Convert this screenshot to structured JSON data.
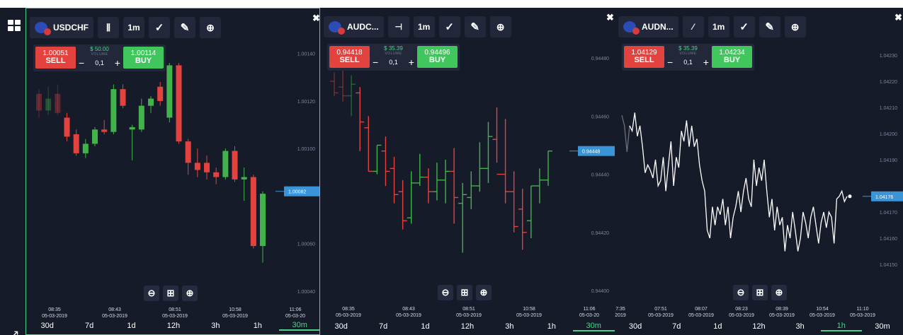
{
  "layout_icon": "grid-layout-icon",
  "expand_icon": "expand-arrow-icon",
  "close_label": "✖",
  "zoom_icons": {
    "out": "⊖",
    "fit": "⊞",
    "in": "⊕"
  },
  "panels": [
    {
      "symbol": "USDCHF",
      "chart_type_icon": "candlestick-icon",
      "interval": "1m",
      "sell_price": "1.00051",
      "sell_label": "SELL",
      "buy_price": "1.00114",
      "buy_label": "BUY",
      "margin": "$ 50.00",
      "volume_label": "VOLUME",
      "volume": "0,1",
      "minus": "−",
      "plus": "+",
      "price_labels": [
        "1.00140",
        "1.00120",
        "1.00100",
        "1.00060",
        "1.00040"
      ],
      "current_price": "1.00082",
      "time_ticks": [
        {
          "time": "08:35",
          "date": "05-03-2019"
        },
        {
          "time": "08:43",
          "date": "05-03-2019"
        },
        {
          "time": "08:51",
          "date": "05-03-2019"
        },
        {
          "time": "10:58",
          "date": "05-03-2019"
        },
        {
          "time": "11:06",
          "date": "05-03-20"
        }
      ],
      "timeframes": [
        "30d",
        "7d",
        "1d",
        "12h",
        "3h",
        "1h",
        "30m"
      ],
      "selected_tf": "30m"
    },
    {
      "symbol": "AUDC...",
      "chart_type_icon": "ohlc-bars-icon",
      "interval": "1m",
      "sell_price": "0.94418",
      "sell_label": "SELL",
      "buy_price": "0.94496",
      "buy_label": "BUY",
      "margin": "$ 35.39",
      "volume_label": "VOLUME",
      "volume": "0,1",
      "minus": "−",
      "plus": "+",
      "price_labels": [
        "0.94480",
        "0.94460",
        "0.94440",
        "0.94420",
        "0.94400"
      ],
      "current_price": "0.94448",
      "time_ticks": [
        {
          "time": "08:35",
          "date": "05-03-2019"
        },
        {
          "time": "08:43",
          "date": "05-03-2019"
        },
        {
          "time": "08:51",
          "date": "05-03-2019"
        },
        {
          "time": "10:58",
          "date": "05-03-2019"
        },
        {
          "time": "11:06",
          "date": "05-03-20"
        }
      ],
      "timeframes": [
        "30d",
        "7d",
        "1d",
        "12h",
        "3h",
        "1h",
        "30m"
      ],
      "selected_tf": "30m"
    },
    {
      "symbol": "AUDN...",
      "chart_type_icon": "line-chart-icon",
      "interval": "1m",
      "sell_price": "1.04129",
      "sell_label": "SELL",
      "buy_price": "1.04234",
      "buy_label": "BUY",
      "margin": "$ 35.39",
      "volume_label": "VOLUME",
      "volume": "0,1",
      "minus": "−",
      "plus": "+",
      "price_labels": [
        "1.04230",
        "1.04220",
        "1.04210",
        "1.04200",
        "1.04190",
        "1.04170",
        "1.04160",
        "1.04150"
      ],
      "current_price": "1.04176",
      "time_ticks": [
        {
          "time": "7:35",
          "date": "2019"
        },
        {
          "time": "07:51",
          "date": "05-03-2019"
        },
        {
          "time": "08:07",
          "date": "05-03-2019"
        },
        {
          "time": "08:23",
          "date": "05-03-2019"
        },
        {
          "time": "08:39",
          "date": "05-03-2019"
        },
        {
          "time": "10:54",
          "date": "05-03-2019"
        },
        {
          "time": "11:10",
          "date": "05-03-2019"
        }
      ],
      "timeframes": [
        "30d",
        "7d",
        "1d",
        "12h",
        "3h",
        "1h",
        "30m"
      ],
      "selected_tf": "1h"
    }
  ],
  "chart_data": [
    {
      "type": "candlestick",
      "symbol": "USDCHF",
      "ylim": [
        1.0004,
        1.0015
      ],
      "candles": [
        [
          1.00123,
          1.00125,
          1.00113,
          1.00116
        ],
        [
          1.00116,
          1.00126,
          1.00114,
          1.00121
        ],
        [
          1.00123,
          1.00127,
          1.00114,
          1.00115
        ],
        [
          1.00113,
          1.00115,
          1.00103,
          1.00105
        ],
        [
          1.00106,
          1.00108,
          1.00097,
          1.00098
        ],
        [
          1.00098,
          1.00104,
          1.00096,
          1.00102
        ],
        [
          1.00102,
          1.00109,
          1.00101,
          1.00108
        ],
        [
          1.00108,
          1.00112,
          1.00106,
          1.00107
        ],
        [
          1.00107,
          1.00127,
          1.00106,
          1.00125
        ],
        [
          1.00125,
          1.00127,
          1.00117,
          1.00118
        ],
        [
          1.00108,
          1.0011,
          1.00095,
          1.00109
        ],
        [
          1.00108,
          1.00121,
          1.00107,
          1.00118
        ],
        [
          1.00118,
          1.00122,
          1.00115,
          1.00121
        ],
        [
          1.00126,
          1.00128,
          1.00118,
          1.0012
        ],
        [
          1.00113,
          1.00136,
          1.00111,
          1.00135
        ],
        [
          1.00135,
          1.00136,
          1.00102,
          1.00103
        ],
        [
          1.00103,
          1.00104,
          1.00089,
          1.00094
        ],
        [
          1.00094,
          1.001,
          1.00088,
          1.00091
        ],
        [
          1.00094,
          1.00097,
          1.00087,
          1.0009
        ],
        [
          1.0009,
          1.00092,
          1.00085,
          1.00088
        ],
        [
          1.00088,
          1.001,
          1.00087,
          1.00099
        ],
        [
          1.00099,
          1.00101,
          1.00086,
          1.00087
        ],
        [
          1.00087,
          1.00092,
          1.00078,
          1.00088
        ],
        [
          1.00088,
          1.00089,
          1.00058,
          1.00059
        ],
        [
          1.00059,
          1.00082,
          1.00052,
          1.00081
        ]
      ]
    },
    {
      "type": "ohlc",
      "symbol": "AUDCAD",
      "ylim": [
        0.944,
        0.9449
      ],
      "bars": [
        [
          0.94472,
          0.94475,
          0.94467,
          0.94468
        ],
        [
          0.9447,
          0.94476,
          0.94465,
          0.94467
        ],
        [
          0.94467,
          0.94474,
          0.9446,
          0.94471
        ],
        [
          0.94468,
          0.9447,
          0.94448,
          0.94458
        ],
        [
          0.94456,
          0.9446,
          0.94441,
          0.94441
        ],
        [
          0.94441,
          0.9445,
          0.9444,
          0.9445
        ],
        [
          0.94448,
          0.94453,
          0.94436,
          0.94441
        ],
        [
          0.94442,
          0.94446,
          0.9443,
          0.94433
        ],
        [
          0.94434,
          0.94438,
          0.94421,
          0.94424
        ],
        [
          0.94425,
          0.94441,
          0.94423,
          0.94437
        ],
        [
          0.94437,
          0.94447,
          0.94436,
          0.94439
        ],
        [
          0.94439,
          0.94442,
          0.9443,
          0.94434
        ],
        [
          0.94434,
          0.94444,
          0.94431,
          0.94438
        ],
        [
          0.94438,
          0.94445,
          0.9443,
          0.94441
        ],
        [
          0.94441,
          0.94449,
          0.94423,
          0.94432
        ],
        [
          0.9443,
          0.94437,
          0.94413,
          0.94433
        ],
        [
          0.94432,
          0.94441,
          0.94428,
          0.94436
        ],
        [
          0.94436,
          0.94451,
          0.94434,
          0.94442
        ],
        [
          0.94442,
          0.94458,
          0.94437,
          0.94453
        ],
        [
          0.94452,
          0.94463,
          0.94444,
          0.9444
        ],
        [
          0.9444,
          0.94459,
          0.9443,
          0.94434
        ],
        [
          0.94434,
          0.94441,
          0.9442,
          0.94422
        ],
        [
          0.94428,
          0.94435,
          0.94414,
          0.9442
        ],
        [
          0.94424,
          0.94436,
          0.94418,
          0.94436
        ],
        [
          0.94436,
          0.94442,
          0.9443,
          0.94438
        ],
        [
          0.94438,
          0.94448,
          0.94436,
          0.94448
        ]
      ]
    },
    {
      "type": "line",
      "symbol": "AUDNZD",
      "ylim": [
        1.0414,
        1.0424
      ],
      "values": [
        1.04207,
        1.04203,
        1.04193,
        1.04203,
        1.04201,
        1.04208,
        1.04199,
        1.04203,
        1.04195,
        1.04185,
        1.04188,
        1.04186,
        1.04183,
        1.0419,
        1.0418,
        1.04182,
        1.04191,
        1.04178,
        1.04188,
        1.04197,
        1.0418,
        1.04191,
        1.04187,
        1.04201,
        1.04197,
        1.04205,
        1.04195,
        1.04203,
        1.04195,
        1.04198,
        1.04188,
        1.04182,
        1.04178,
        1.04163,
        1.0416,
        1.04172,
        1.04165,
        1.04172,
        1.04169,
        1.04175,
        1.04165,
        1.04172,
        1.0416,
        1.04168,
        1.04172,
        1.04178,
        1.0417,
        1.04178,
        1.04183,
        1.04175,
        1.04172,
        1.0419,
        1.0418,
        1.04187,
        1.04182,
        1.0419,
        1.04178,
        1.04168,
        1.04175,
        1.04163,
        1.04172,
        1.04165,
        1.04168,
        1.04155,
        1.04165,
        1.0416,
        1.0417,
        1.04163,
        1.04155,
        1.0416,
        1.0417,
        1.04166,
        1.0416,
        1.04168,
        1.04172,
        1.04165,
        1.04158,
        1.04166,
        1.0417,
        1.04164,
        1.0417,
        1.04168,
        1.04158,
        1.04175,
        1.04176,
        1.04178,
        1.04174,
        1.04176
      ]
    }
  ]
}
